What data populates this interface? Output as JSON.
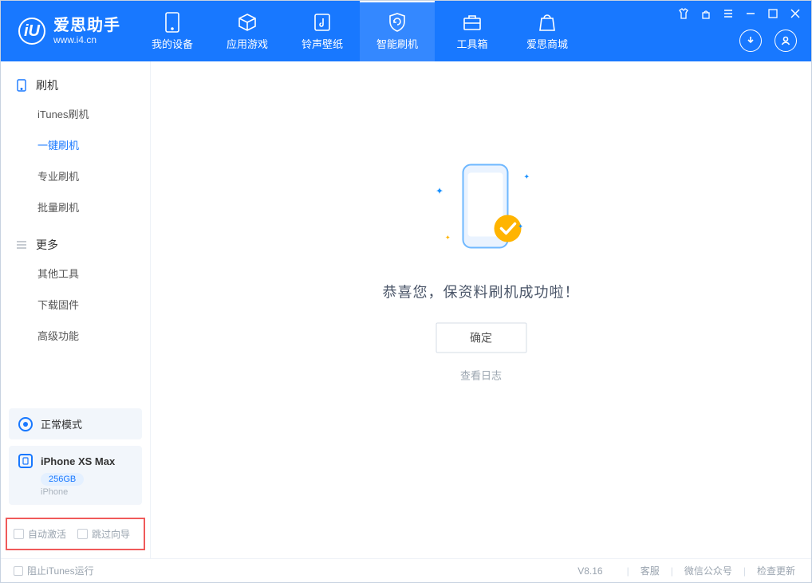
{
  "app": {
    "title": "爱思助手",
    "subtitle": "www.i4.cn"
  },
  "nav": {
    "tabs": [
      {
        "label": "我的设备"
      },
      {
        "label": "应用游戏"
      },
      {
        "label": "铃声壁纸"
      },
      {
        "label": "智能刷机"
      },
      {
        "label": "工具箱"
      },
      {
        "label": "爱思商城"
      }
    ]
  },
  "sidebar": {
    "group_flash": {
      "title": "刷机",
      "items": [
        "iTunes刷机",
        "一键刷机",
        "专业刷机",
        "批量刷机"
      ]
    },
    "group_more": {
      "title": "更多",
      "items": [
        "其他工具",
        "下载固件",
        "高级功能"
      ]
    },
    "mode_label": "正常模式",
    "device": {
      "name": "iPhone XS Max",
      "storage": "256GB",
      "type": "iPhone"
    },
    "check_auto_activate": "自动激活",
    "check_skip_guide": "跳过向导"
  },
  "content": {
    "success_text": "恭喜您，保资料刷机成功啦！",
    "ok_button": "确定",
    "view_log": "查看日志"
  },
  "footer": {
    "block_itunes": "阻止iTunes运行",
    "version": "V8.16",
    "links": [
      "客服",
      "微信公众号",
      "检查更新"
    ]
  },
  "colors": {
    "primary": "#1878ff",
    "accent": "#ffb400"
  }
}
